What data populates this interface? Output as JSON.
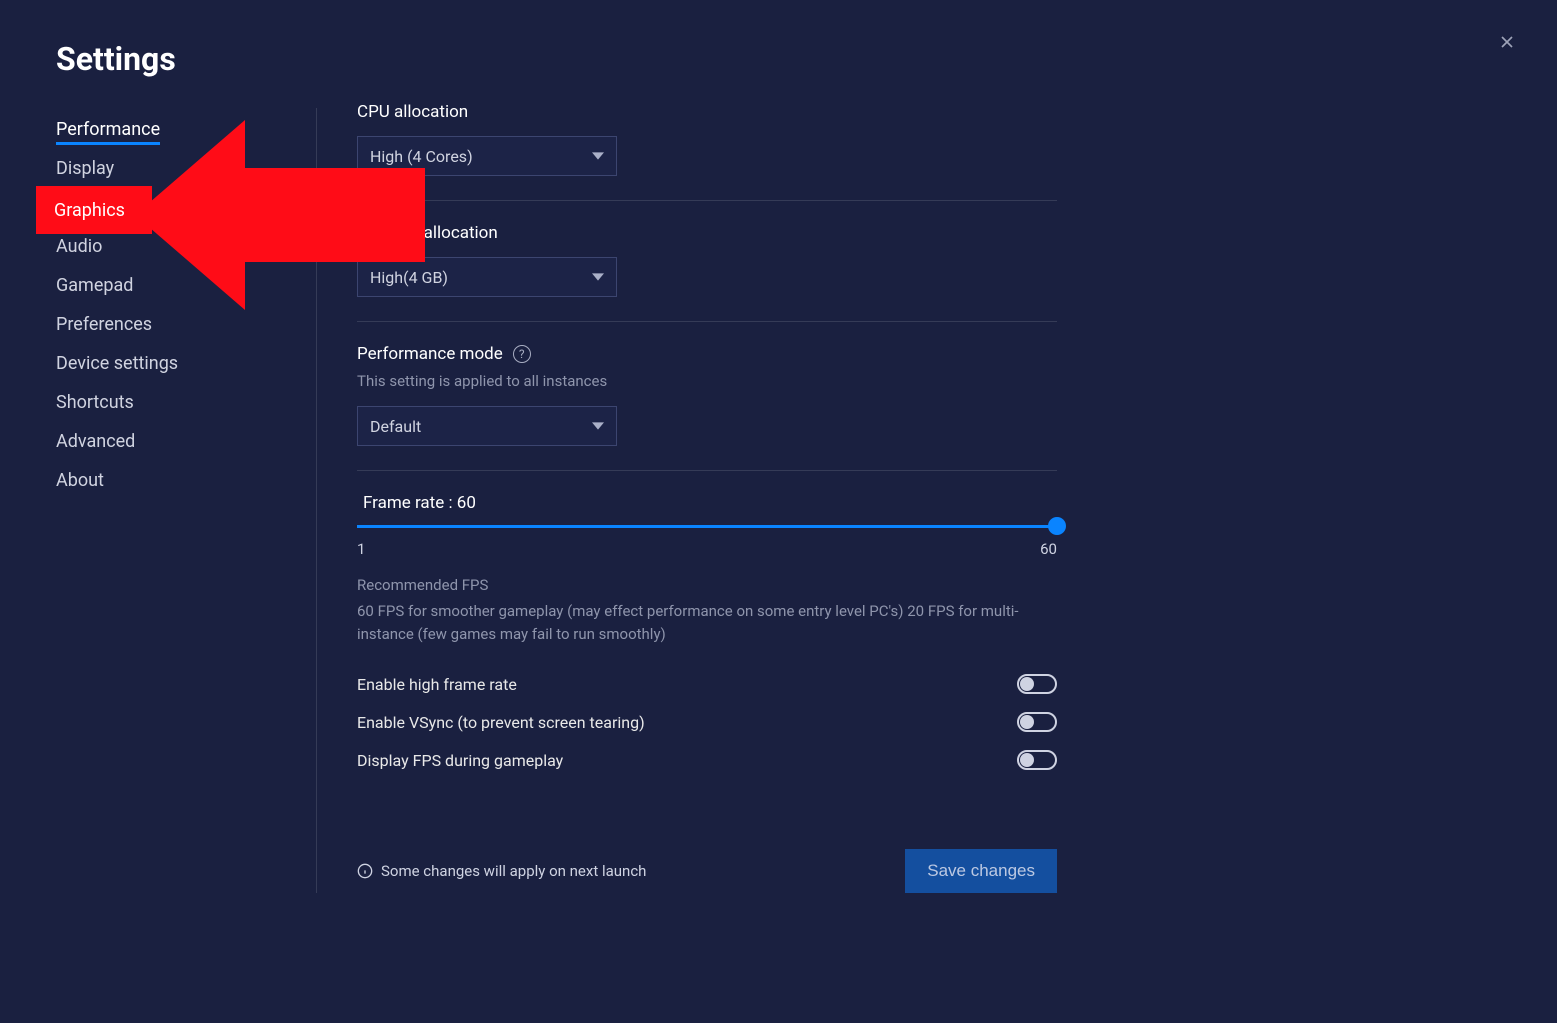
{
  "title": "Settings",
  "sidebar": {
    "items": [
      {
        "label": "Performance",
        "active": true
      },
      {
        "label": "Display"
      },
      {
        "label": "Graphics"
      },
      {
        "label": "Audio"
      },
      {
        "label": "Gamepad"
      },
      {
        "label": "Preferences"
      },
      {
        "label": "Device settings"
      },
      {
        "label": "Shortcuts"
      },
      {
        "label": "Advanced"
      },
      {
        "label": "About"
      }
    ]
  },
  "cpu": {
    "label": "CPU allocation",
    "value": "High (4 Cores)"
  },
  "memory": {
    "label": "Memory allocation",
    "value": "High(4 GB)"
  },
  "perfmode": {
    "label": "Performance mode",
    "help": "?",
    "sub": "This setting is applied to all instances",
    "value": "Default"
  },
  "framerate": {
    "label": "Frame rate : 60",
    "min": "1",
    "max": "60"
  },
  "rec": {
    "title": "Recommended FPS",
    "body": "60 FPS for smoother gameplay (may effect performance on some entry level PC's) 20 FPS for multi-instance (few games may fail to run smoothly)"
  },
  "toggles": {
    "hfr": "Enable high frame rate",
    "vsync": "Enable VSync (to prevent screen tearing)",
    "showfps": "Display FPS during gameplay"
  },
  "footer": {
    "note": "Some changes will apply on next launch",
    "save": "Save changes"
  },
  "annotation": {
    "highlight_label": "Graphics"
  }
}
